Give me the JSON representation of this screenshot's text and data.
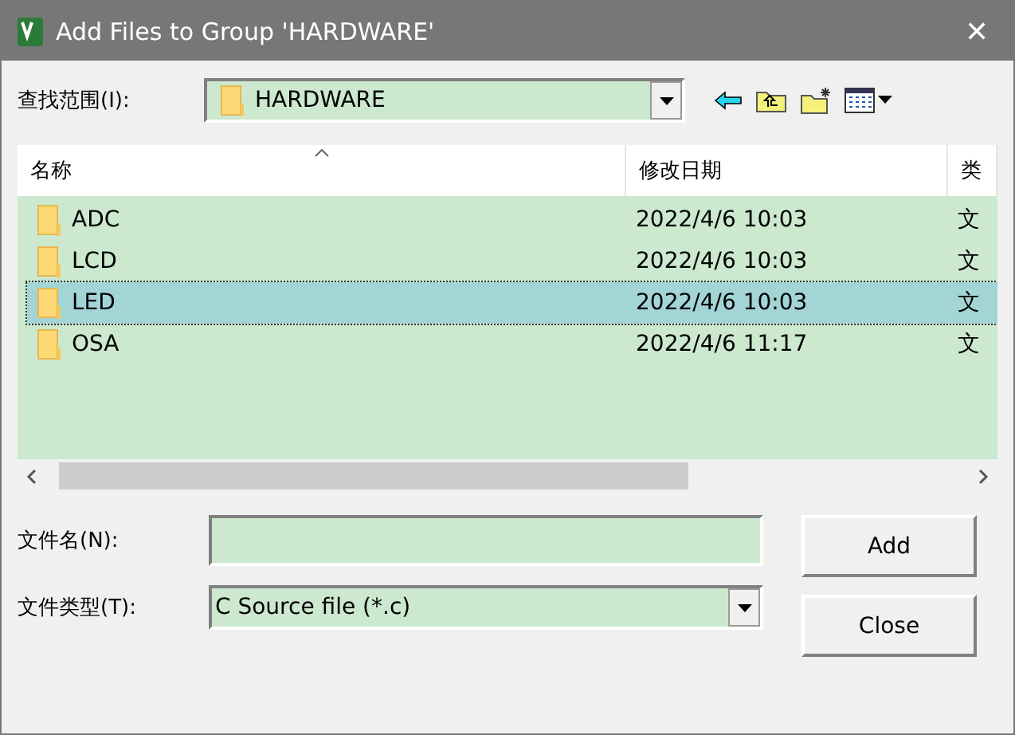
{
  "window": {
    "title": "Add Files to Group 'HARDWARE'",
    "close": "✕"
  },
  "look_in": {
    "label": "查找范围(I):",
    "value": "HARDWARE"
  },
  "list": {
    "columns": [
      "名称",
      "修改日期",
      "类"
    ],
    "rows": [
      {
        "name": "ADC",
        "date": "2022/4/6 10:03",
        "type": "文",
        "selected": false
      },
      {
        "name": "LCD",
        "date": "2022/4/6 10:03",
        "type": "文",
        "selected": false
      },
      {
        "name": "LED",
        "date": "2022/4/6 10:03",
        "type": "文",
        "selected": true
      },
      {
        "name": "OSA",
        "date": "2022/4/6 11:17",
        "type": "文",
        "selected": false
      }
    ]
  },
  "file_name": {
    "label": "文件名(N):"
  },
  "file_type": {
    "label": "文件类型(T):",
    "value": "C Source file (*.c)"
  },
  "buttons": [
    "Add",
    "Close"
  ]
}
